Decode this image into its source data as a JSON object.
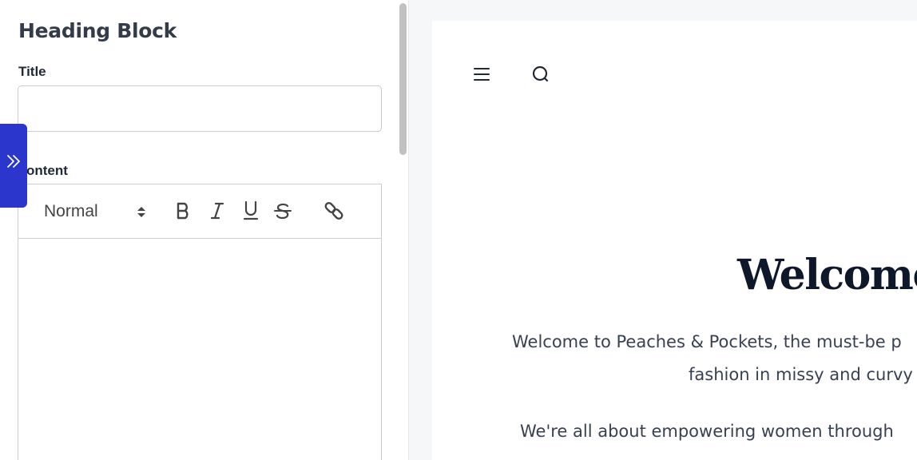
{
  "editor": {
    "block_title": "Heading Block",
    "title_field": {
      "label": "Title",
      "value": "",
      "placeholder": ""
    },
    "content_field": {
      "label": "Content",
      "label_visible": "ontent",
      "format_select": "Normal",
      "toolbar": {
        "bold": "B",
        "italic": "I",
        "underline": "U",
        "strike": "S"
      },
      "value": ""
    },
    "collapse_icon": "double-chevron-right-icon"
  },
  "preview": {
    "heading": "Welcome",
    "paragraph_line1": "Welcome to Peaches & Pockets, the must-be p",
    "paragraph_line2": "fashion in missy and curvy",
    "paragraph2_line1": "We're all about empowering women through"
  },
  "colors": {
    "accent": "#2a36cc",
    "heading_dark": "#0f172a",
    "border": "#c9ccd1",
    "preview_bg": "#f6f7f9"
  }
}
